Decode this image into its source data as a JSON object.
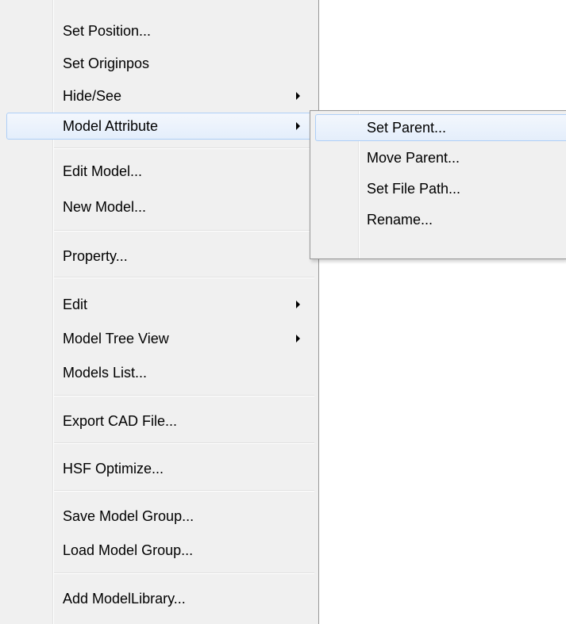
{
  "menu": {
    "items": [
      {
        "label": "Set Position...",
        "submenu": false
      },
      {
        "label": "Set Originpos",
        "submenu": false
      },
      {
        "label": "Hide/See",
        "submenu": true
      },
      {
        "label": "Model Attribute",
        "submenu": true,
        "highlighted": true
      },
      {
        "label": "Edit Model...",
        "submenu": false
      },
      {
        "label": "New Model...",
        "submenu": false
      },
      {
        "label": "Property...",
        "submenu": false
      },
      {
        "label": "Edit",
        "submenu": true
      },
      {
        "label": "Model Tree View",
        "submenu": true
      },
      {
        "label": "Models List...",
        "submenu": false
      },
      {
        "label": "Export CAD File...",
        "submenu": false
      },
      {
        "label": "HSF Optimize...",
        "submenu": false
      },
      {
        "label": "Save Model Group...",
        "submenu": false
      },
      {
        "label": "Load Model Group...",
        "submenu": false
      },
      {
        "label": "Add ModelLibrary...",
        "submenu": false
      }
    ]
  },
  "submenu": {
    "parent": "Model Attribute",
    "items": [
      {
        "label": "Set Parent...",
        "highlighted": true
      },
      {
        "label": "Move Parent..."
      },
      {
        "label": "Set File Path..."
      },
      {
        "label": "Rename..."
      }
    ]
  },
  "colors": {
    "menu_background": "#f0f0f0",
    "highlight_border": "#aecff7",
    "highlight_fill": "#e8f0fb",
    "border": "#979797"
  },
  "icons": {
    "submenu_arrow": "chevron-right-icon"
  }
}
